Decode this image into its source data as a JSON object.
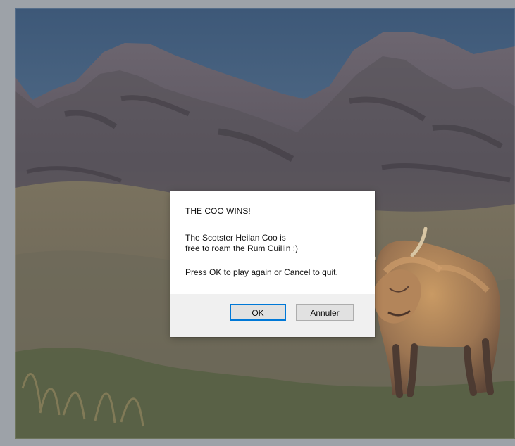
{
  "dialog": {
    "title_message": "THE COO WINS!",
    "message_line_2": "The Scotster Heilan Coo is",
    "message_line_3": "free to roam the Rum Cuillin :)",
    "message_line_4": "Press OK to play again or Cancel to quit.",
    "ok_label": "OK",
    "cancel_label": "Annuler"
  },
  "scene": {
    "subject": "highland-cow-icon",
    "background": "mountain-landscape"
  },
  "colors": {
    "dialog_background": "#ffffff",
    "dialog_footer": "#f0f0f0",
    "button_focus": "#0078d7",
    "sky": "#4d6886",
    "mountain": "#605b62",
    "grass": "#6d6658",
    "cow": "#9b7553"
  }
}
